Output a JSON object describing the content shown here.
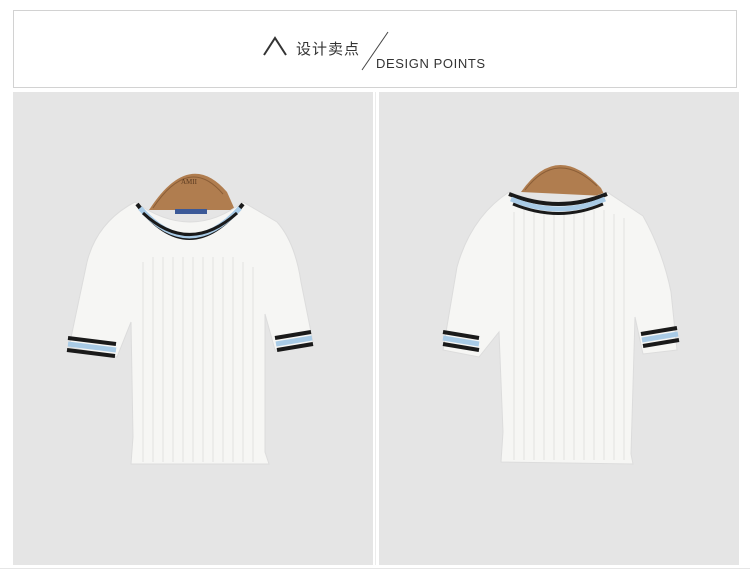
{
  "header": {
    "logo_icon": "chevron-up-icon",
    "title_cn": "设计卖点",
    "title_en": "DESIGN POINTS"
  },
  "photos": {
    "front": {
      "description_icon": "white-ribbed-knit-tee-front",
      "hanger_label": "AMII"
    },
    "back": {
      "description_icon": "white-ribbed-knit-tee-back"
    }
  },
  "colors": {
    "panel_background": "#e5e5e5",
    "stripe_black": "#1a1a1a",
    "stripe_blue": "#a9cbe6",
    "knit_white": "#f6f6f4",
    "hanger_wood": "#b07d4f"
  }
}
